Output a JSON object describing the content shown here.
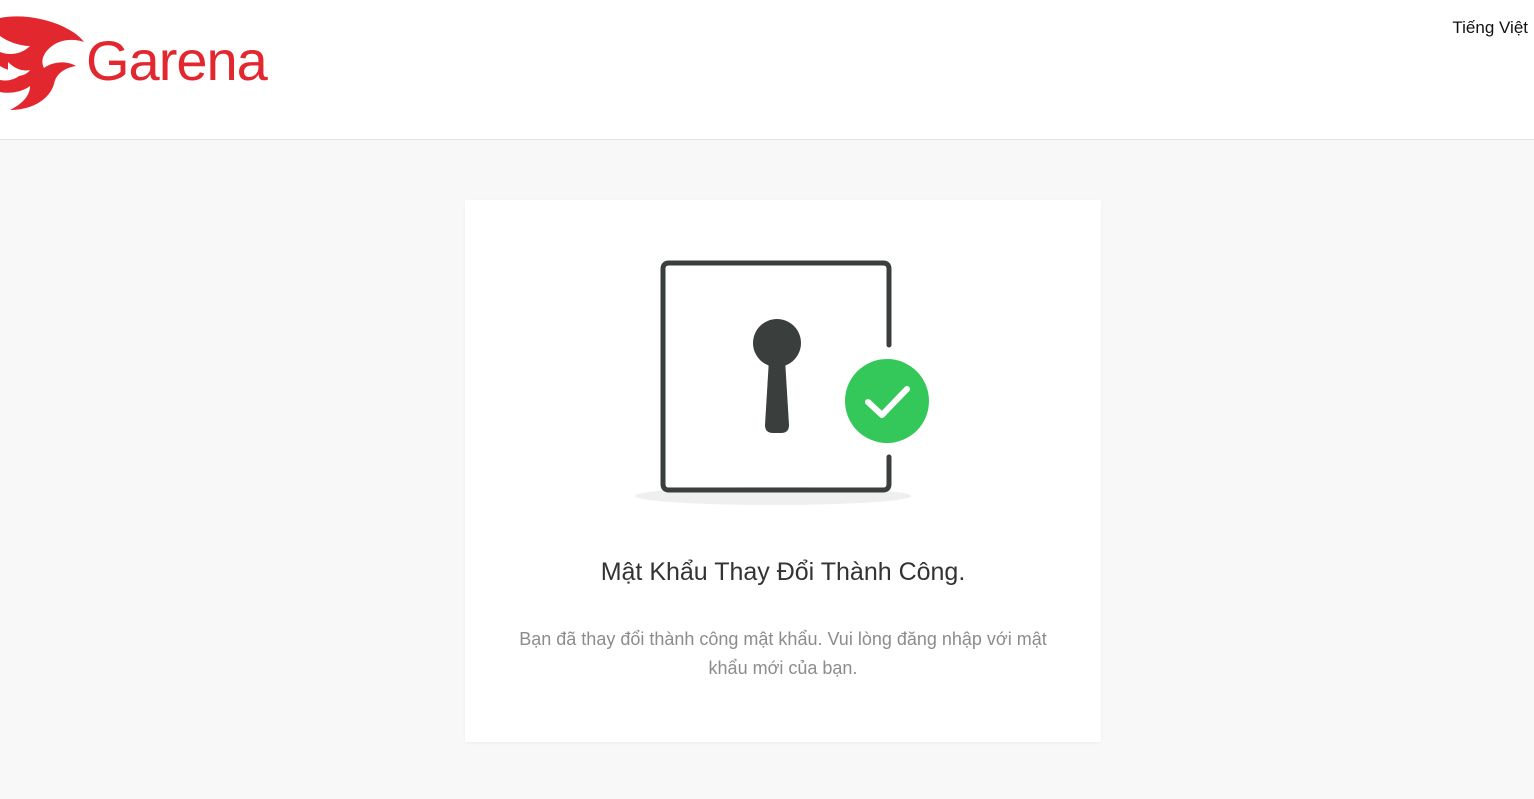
{
  "header": {
    "brand": "Garena",
    "language_label": "Tiếng Việt"
  },
  "icons": {
    "logo": "garena-dragon-icon",
    "illustration": "keyhole-door-icon",
    "success": "check-circle-icon"
  },
  "colors": {
    "brand_red": "#e2272f",
    "success_green": "#34c759",
    "icon_dark": "#3a3f3d"
  },
  "card": {
    "title": "Mật Khẩu Thay Đổi Thành Công.",
    "description": "Bạn đã thay đổi thành công mật khẩu. Vui lòng đăng nhập với mật khẩu mới của bạn."
  }
}
